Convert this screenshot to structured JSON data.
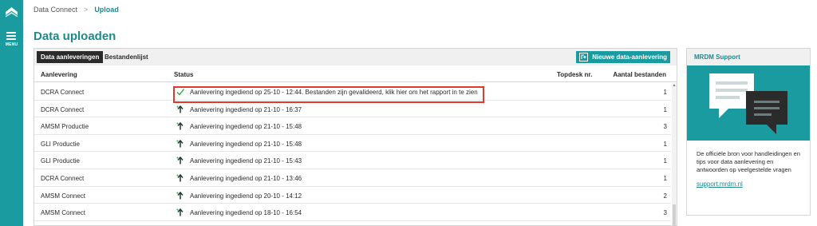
{
  "sidebar": {
    "menu_label": "MENU",
    "logo_icon": "chevron-up-logo",
    "menu_icon": "hamburger-icon",
    "color": "#1a9ba0"
  },
  "breadcrumb": {
    "parent": "Data Connect",
    "current": "Upload"
  },
  "page": {
    "title": "Data uploaden"
  },
  "tabs": [
    {
      "label": "Data aanleveringen",
      "active": true
    },
    {
      "label": "Bestandenlijst",
      "active": false
    }
  ],
  "new_button": {
    "label": "Nieuwe data-aanlevering",
    "icon": "new-delivery-icon"
  },
  "table": {
    "columns": {
      "aanlevering": "Aanlevering",
      "status": "Status",
      "topdesk": "Topdesk nr.",
      "aantal": "Aantal bestanden"
    },
    "rows": [
      {
        "name": "DCRA Connect",
        "status": "Aanlevering ingediend op 25-10 - 12:44. Bestanden zijn gevalideerd, klik hier om het rapport in te zien",
        "icon": "check-icon",
        "topdesk": "",
        "count": "1"
      },
      {
        "name": "DCRA Connect",
        "status": "Aanlevering ingediend op 21-10 - 16:37",
        "icon": "upload-arrow-icon",
        "topdesk": "",
        "count": "1"
      },
      {
        "name": "AMSM Productie",
        "status": "Aanlevering ingediend op 21-10 - 15:48",
        "icon": "upload-arrow-icon",
        "topdesk": "",
        "count": "3"
      },
      {
        "name": "GLI Productie",
        "status": "Aanlevering ingediend op 21-10 - 15:48",
        "icon": "upload-arrow-icon",
        "topdesk": "",
        "count": "1"
      },
      {
        "name": "GLI Productie",
        "status": "Aanlevering ingediend op 21-10 - 15:43",
        "icon": "upload-arrow-icon",
        "topdesk": "",
        "count": "1"
      },
      {
        "name": "DCRA Connect",
        "status": "Aanlevering ingediend op 21-10 - 13:46",
        "icon": "upload-arrow-icon",
        "topdesk": "",
        "count": "1"
      },
      {
        "name": "AMSM Connect",
        "status": "Aanlevering ingediend op 20-10 - 14:12",
        "icon": "upload-arrow-icon",
        "topdesk": "",
        "count": "2"
      },
      {
        "name": "AMSM Connect",
        "status": "Aanlevering ingediend op 18-10 - 16:54",
        "icon": "upload-arrow-icon",
        "topdesk": "",
        "count": "3"
      }
    ]
  },
  "support": {
    "title": "MRDM Support",
    "illustration": "chat-bubbles-illustration",
    "description": "De officiële bron voor handleidingen en tips voor data aanlevering en antwoorden op veelgestelde vragen",
    "link": "support.mrdm.nl"
  },
  "colors": {
    "accent": "#1a9ba0",
    "accent_text": "#1a8a8f",
    "highlight": "#e03a2b",
    "check": "#2eaa4a"
  }
}
